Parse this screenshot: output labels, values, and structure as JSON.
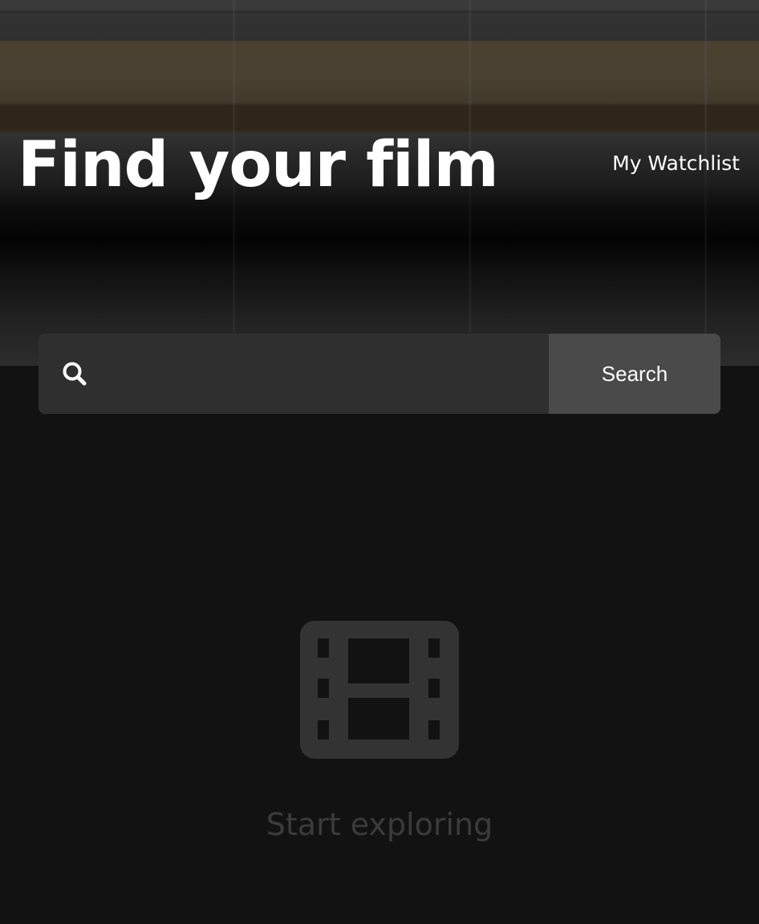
{
  "header": {
    "title": "Find your film",
    "watchlist_link": "My Watchlist"
  },
  "search": {
    "value": "",
    "placeholder": "",
    "button_label": "Search",
    "icon": "search-icon"
  },
  "empty_state": {
    "icon": "film-icon",
    "message": "Start exploring"
  },
  "colors": {
    "background": "#121212",
    "search_field": "#2f2f2f",
    "search_button": "#4a4a4a",
    "muted_icon": "#333333",
    "muted_text": "#3b3b3b",
    "text": "#ffffff"
  }
}
